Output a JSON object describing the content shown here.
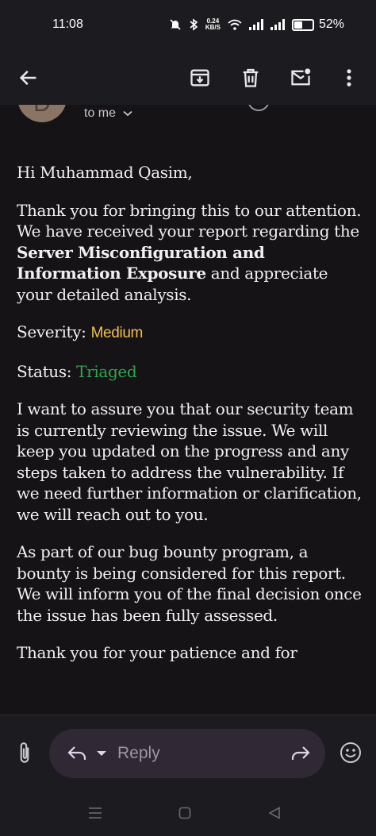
{
  "status_bar": {
    "time": "11:08",
    "net_speed_value": "0.24",
    "net_speed_unit": "KB/S",
    "battery_percent": "52%",
    "battery_level": 0.52
  },
  "toolbar": {
    "back": "back-arrow-icon",
    "archive": "archive-icon",
    "delete": "trash-icon",
    "mark_unread": "mark-unread-icon",
    "more": "more-vert-icon"
  },
  "header": {
    "avatar_initial": "D",
    "recipient": "to me"
  },
  "email": {
    "greeting": "Hi Muhammad Qasim,",
    "p1_pre": "Thank you for bringing this to our attention. We have received your report regarding the ",
    "p1_bold": "Server Misconfiguration and Information Exposure",
    "p1_post": " and appreciate your detailed analysis.",
    "severity_label": "Severity: ",
    "severity_value": "Medium",
    "status_label": "Status: ",
    "status_value": "Triaged",
    "p2": "I want to assure you that our security team is currently reviewing the issue. We will keep you updated on the progress and any steps taken to address the vulnerability. If we need further information or clarification, we will reach out to you.",
    "p3": "As part of our bug bounty program, a bounty is being considered for this report. We will inform you of the final decision once the issue has been fully assessed.",
    "p4": "Thank you for your patience and for"
  },
  "reply_bar": {
    "placeholder": "Reply"
  },
  "colors": {
    "severity": "#f2bf4a",
    "status": "#2fa84f"
  }
}
